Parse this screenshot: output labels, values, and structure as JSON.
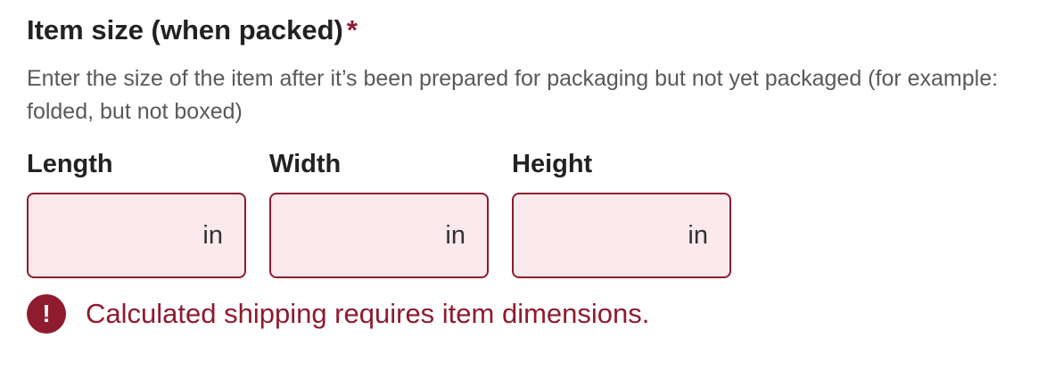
{
  "section": {
    "title": "Item size (when packed)",
    "required_marker": "*",
    "help_text": "Enter the size of the item after it’s been prepared for packaging but not yet packaged (for example: folded, but not boxed)"
  },
  "dimensions": [
    {
      "label": "Length",
      "value": "",
      "unit": "in"
    },
    {
      "label": "Width",
      "value": "",
      "unit": "in"
    },
    {
      "label": "Height",
      "value": "",
      "unit": "in"
    }
  ],
  "error": {
    "icon": "exclamation-icon",
    "glyph": "!",
    "message": "Calculated shipping requires item dimensions."
  },
  "colors": {
    "error": "#8f1b2e",
    "error_fill": "#fbe9ed",
    "text": "#222222",
    "muted_text": "#595959"
  }
}
